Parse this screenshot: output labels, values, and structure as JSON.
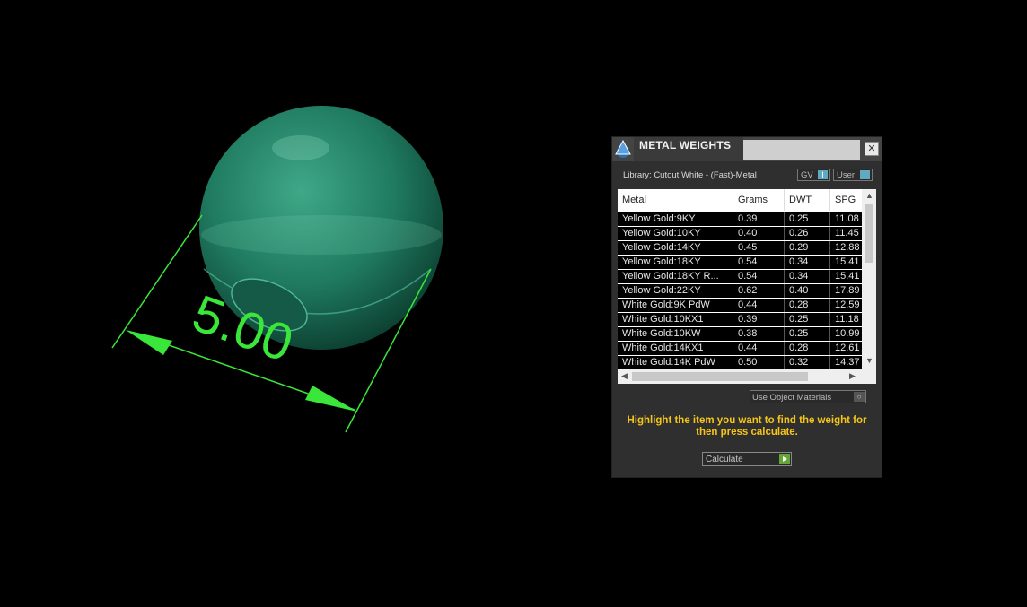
{
  "viewport": {
    "dimension_label": "5.00",
    "dimension_color": "#39e639",
    "sphere_color": "#1f7a5f"
  },
  "panel": {
    "title": "METAL WEIGHTS",
    "close_label": "✕",
    "library_label": "Library: Cutout White - (Fast)-Metal",
    "gv_label": "GV",
    "gv_knob": "I",
    "user_label": "User",
    "user_knob": "I",
    "table": {
      "headers": [
        "Metal",
        "Grams",
        "DWT",
        "SPG"
      ],
      "rows": [
        [
          "Yellow Gold:9KY",
          "0.39",
          "0.25",
          "11.08"
        ],
        [
          "Yellow Gold:10KY",
          "0.40",
          "0.26",
          "11.45"
        ],
        [
          "Yellow Gold:14KY",
          "0.45",
          "0.29",
          "12.88"
        ],
        [
          "Yellow Gold:18KY",
          "0.54",
          "0.34",
          "15.41"
        ],
        [
          "Yellow Gold:18KY R...",
          "0.54",
          "0.34",
          "15.41"
        ],
        [
          "Yellow Gold:22KY",
          "0.62",
          "0.40",
          "17.89"
        ],
        [
          "White Gold:9K PdW",
          "0.44",
          "0.28",
          "12.59"
        ],
        [
          "White Gold:10KX1",
          "0.39",
          "0.25",
          "11.18"
        ],
        [
          "White Gold:10KW",
          "0.38",
          "0.25",
          "10.99"
        ],
        [
          "White Gold:14KX1",
          "0.44",
          "0.28",
          "12.61"
        ],
        [
          "White Gold:14K PdW",
          "0.50",
          "0.32",
          "14.37"
        ]
      ]
    },
    "use_object_materials_label": "Use Object Materials",
    "hint_text": "Highlight the item you want to find the weight for then press calculate.",
    "calculate_label": "Calculate",
    "accent": "#f5c518"
  }
}
